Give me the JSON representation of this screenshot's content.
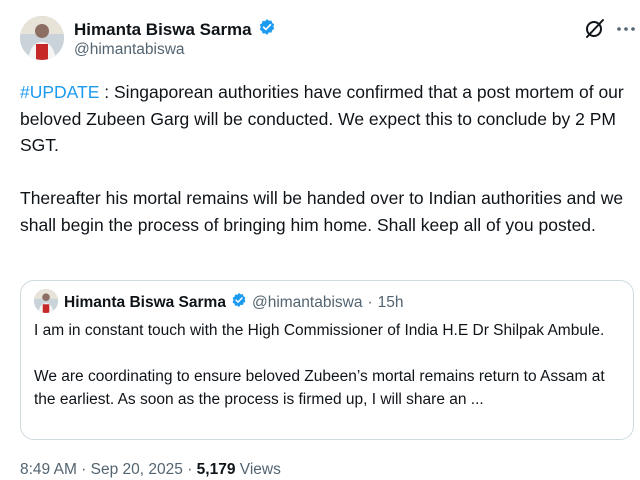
{
  "author": {
    "name": "Himanta Biswa Sarma",
    "handle": "@himantabiswa"
  },
  "tweet": {
    "hashtag": "#UPDATE",
    "text_part1": " : Singaporean authorities have confirmed that a post mortem of our beloved Zubeen Garg will be conducted.  We expect this to conclude by 2 PM SGT.",
    "text_part2": "Thereafter his mortal remains will be handed over to Indian authorities and we shall begin the process of bringing him home. Shall keep all of you posted."
  },
  "quoted_tweet": {
    "name": "Himanta Biswa Sarma",
    "handle": "@himantabiswa",
    "separator": "·",
    "time": "15h",
    "text_part1": "I am in constant touch with the High Commissioner of India H.E Dr Shilpak Ambule.",
    "text_part2": "We are coordinating to ensure beloved Zubeen’s mortal remains return to Assam at the earliest. As soon as the process is firmed up, I will share an ..."
  },
  "footer": {
    "time": "8:49 AM",
    "sep1": " · ",
    "date": "Sep 20, 2025",
    "sep2": " · ",
    "views_count": "5,179",
    "views_label": " Views"
  },
  "icons": {
    "verified": "verified-badge-icon",
    "grok": "grok-icon",
    "more": "more-icon"
  },
  "colors": {
    "accent": "#1d9bf0",
    "text": "#0f1419",
    "muted": "#536471",
    "border": "#cfd9de"
  }
}
